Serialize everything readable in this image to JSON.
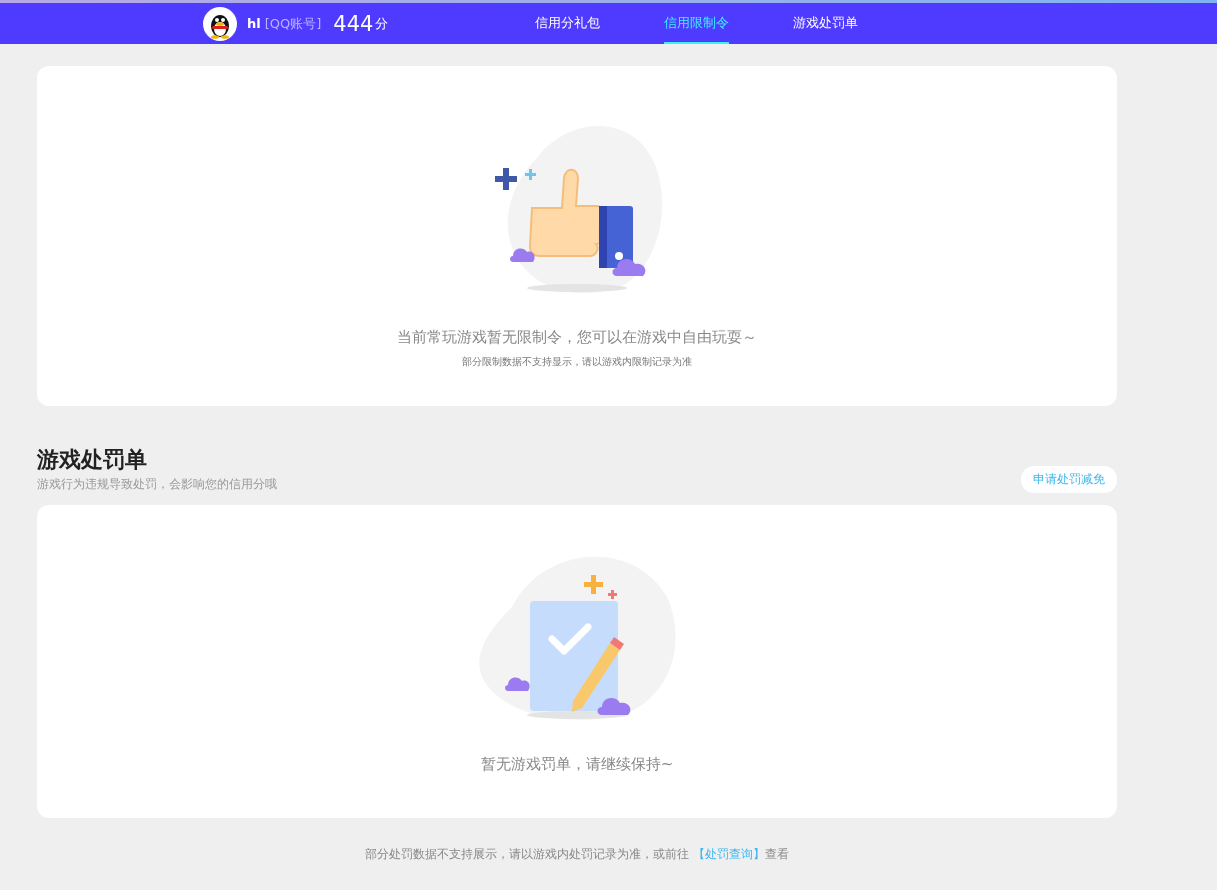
{
  "header": {
    "username": "hl",
    "account_type": "[QQ账号]",
    "score": "444",
    "score_unit": "分"
  },
  "nav": [
    {
      "label": "信用分礼包",
      "selected": false
    },
    {
      "label": "信用限制令",
      "selected": true
    },
    {
      "label": "游戏处罚单",
      "selected": false
    }
  ],
  "restriction_card": {
    "message": "当前常玩游戏暂无限制令，您可以在游戏中自由玩耍～",
    "note": "部分限制数据不支持显示，请以游戏内限制记录为准"
  },
  "penalty_section": {
    "title": "游戏处罚单",
    "subtitle": "游戏行为违规导致处罚，会影响您的信用分哦",
    "action_button": "申请处罚减免",
    "message": "暂无游戏罚单，请继续保持~"
  },
  "footer": {
    "text_before": "部分处罚数据不支持展示，请以游戏内处罚记录为准，或前往",
    "link": "【处罚查询】",
    "text_after": "查看"
  }
}
